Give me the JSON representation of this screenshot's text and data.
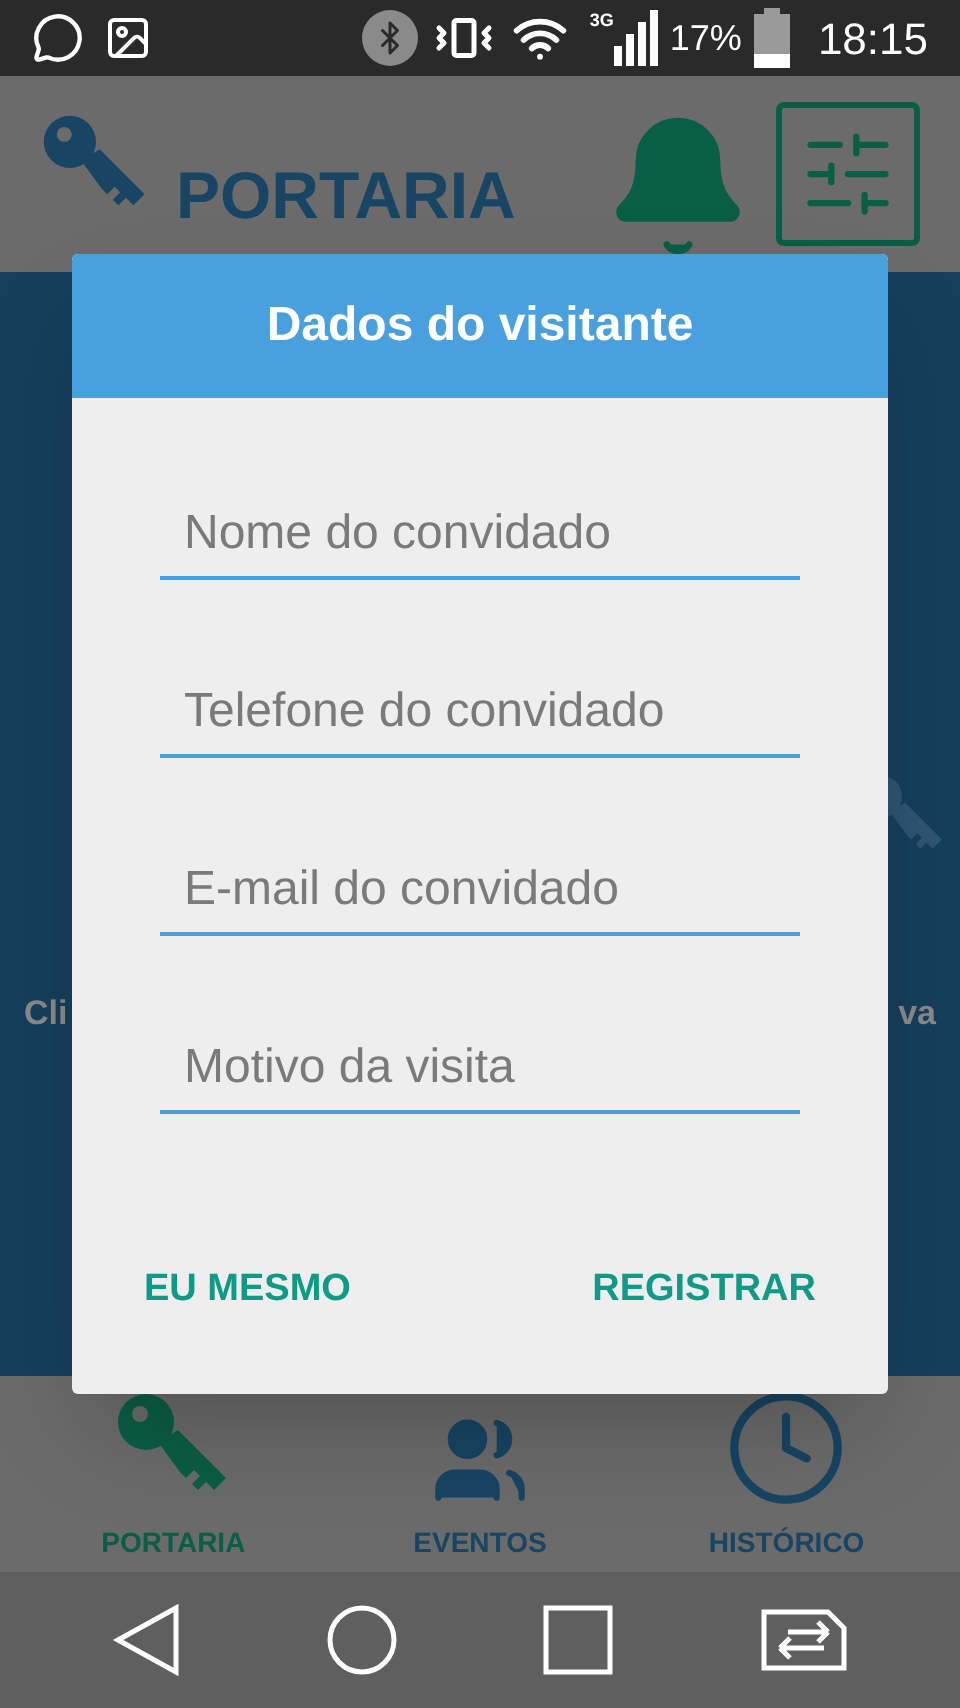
{
  "status_bar": {
    "network": "3G",
    "battery": "17%",
    "time": "18:15"
  },
  "header": {
    "title": "PORTARIA"
  },
  "background_labels": [
    "Cli",
    "va"
  ],
  "dialog": {
    "title": "Dados do visitante",
    "fields": [
      {
        "placeholder": "Nome do convidado"
      },
      {
        "placeholder": "Telefone do convidado"
      },
      {
        "placeholder": "E-mail do convidado"
      },
      {
        "placeholder": "Motivo da visita"
      }
    ],
    "buttons": [
      "EU MESMO",
      "REGISTRAR"
    ]
  },
  "bottom_nav": [
    {
      "label": "PORTARIA",
      "kind": "key",
      "selected": true
    },
    {
      "label": "EVENTOS",
      "kind": "people",
      "selected": false
    },
    {
      "label": "HISTÓRICO",
      "kind": "clock",
      "selected": false
    }
  ]
}
